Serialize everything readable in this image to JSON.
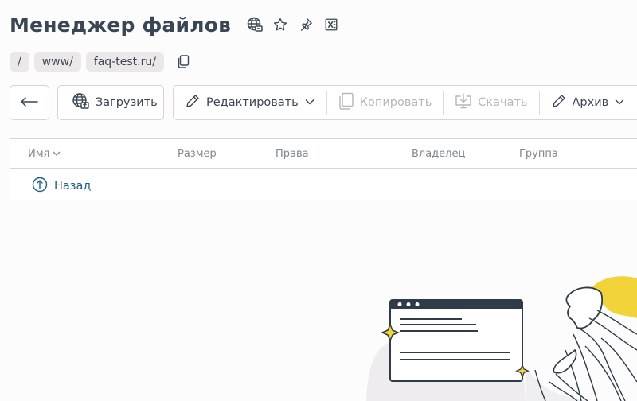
{
  "header": {
    "title": "Менеджер файлов",
    "icons": [
      "globe-icon",
      "star-icon",
      "pin-icon",
      "excel-icon"
    ]
  },
  "breadcrumb": {
    "items": [
      "/",
      "www/",
      "faq-test.ru/"
    ],
    "copy_icon": "copy-icon"
  },
  "toolbar": {
    "back_icon": "arrow-left-icon",
    "upload_label": "Загрузить",
    "edit_label": "Редактировать",
    "copy_label": "Копировать",
    "download_label": "Скачать",
    "archive_label": "Архив"
  },
  "table": {
    "columns": [
      "Имя",
      "Размер",
      "Права",
      "Владелец",
      "Группа"
    ],
    "back_row_label": "Назад"
  },
  "colors": {
    "title": "#3b4654",
    "link": "#1f5f86",
    "disabled": "#b7b6b9",
    "accent_yellow": "#f2d43a"
  }
}
